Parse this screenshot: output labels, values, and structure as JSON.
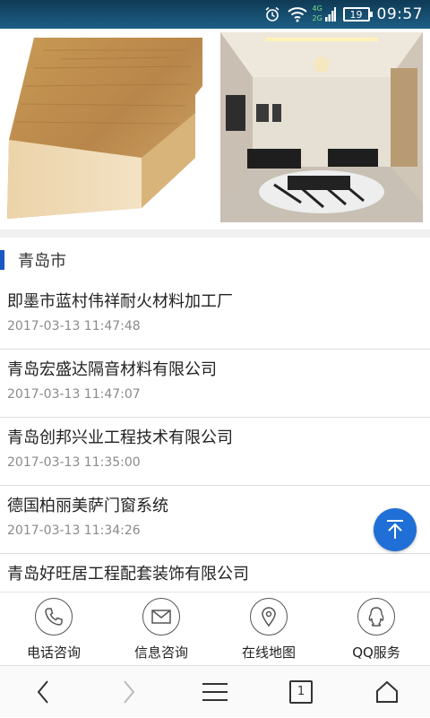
{
  "status_bar": {
    "time": "09:57",
    "battery": "19",
    "network": "4G",
    "network2": "2G",
    "icons": [
      "alarm-icon",
      "wifi-icon",
      "signal-icon",
      "battery-icon"
    ]
  },
  "banner": {
    "images": [
      "wood-molding-image",
      "living-room-image"
    ]
  },
  "section": {
    "title": "青岛市"
  },
  "list": [
    {
      "title": "即墨市蓝村伟祥耐火材料加工厂",
      "date": "2017-03-13 11:47:48"
    },
    {
      "title": "青岛宏盛达隔音材料有限公司",
      "date": "2017-03-13 11:47:07"
    },
    {
      "title": "青岛创邦兴业工程技术有限公司",
      "date": "2017-03-13 11:35:00"
    },
    {
      "title": "德国柏丽美萨门窗系统",
      "date": "2017-03-13 11:34:26"
    },
    {
      "title": "青岛好旺居工程配套装饰有限公司",
      "date": ""
    }
  ],
  "back_to_top": {
    "icon": "arrow-up-icon"
  },
  "toolbar": {
    "phone_label": "电话咨询",
    "message_label": "信息咨询",
    "map_label": "在线地图",
    "qq_label": "QQ服务"
  },
  "navbar": {
    "tab_count": "1",
    "icons": [
      "back-icon",
      "forward-icon",
      "menu-icon",
      "tabs-icon",
      "home-icon"
    ]
  },
  "colors": {
    "accent": "#1a56c4",
    "back_to_top": "#1f6fd6",
    "status_bar": "#1d5f86"
  }
}
